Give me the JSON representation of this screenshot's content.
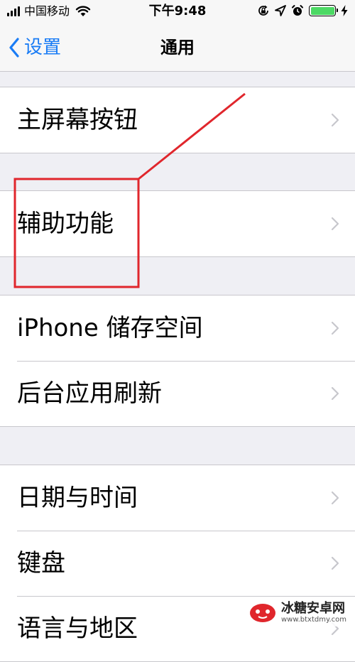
{
  "status_bar": {
    "carrier": "中国移动",
    "time": "下午9:48",
    "battery_color": "#4cd964"
  },
  "nav": {
    "back_label": "设置",
    "title": "通用",
    "accent": "#1a7cf5"
  },
  "groups": [
    {
      "items": [
        {
          "label": "主屏幕按钮"
        }
      ]
    },
    {
      "items": [
        {
          "label": "辅助功能"
        }
      ]
    },
    {
      "items": [
        {
          "label": "iPhone 储存空间"
        },
        {
          "label": "后台应用刷新"
        }
      ]
    },
    {
      "items": [
        {
          "label": "日期与时间"
        },
        {
          "label": "键盘"
        },
        {
          "label": "语言与地区"
        }
      ]
    }
  ],
  "annotation": {
    "color": "#e0262c"
  },
  "watermark": {
    "name": "冰糖安卓网",
    "url": "www.btxtdmy.com"
  }
}
